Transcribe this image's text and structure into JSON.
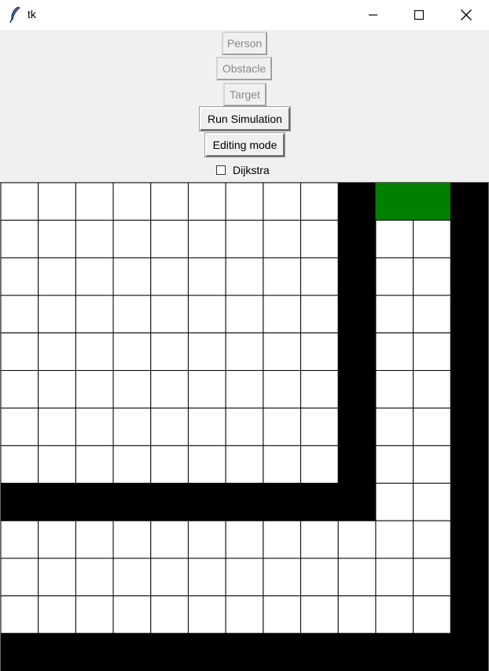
{
  "window": {
    "title": "tk",
    "icon": "feather-icon",
    "controls": [
      "minimize-icon",
      "maximize-icon",
      "close-icon"
    ]
  },
  "toolbar": {
    "person_label": "Person",
    "obstacle_label": "Obstacle",
    "target_label": "Target",
    "run_label": "Run Simulation",
    "editing_label": "Editing mode",
    "dijkstra_label": "Dijkstra",
    "dijkstra_checked": false
  },
  "grid": {
    "cols": 13,
    "rows": 13,
    "colors": {
      "empty": "#ffffff",
      "obstacle": "#000000",
      "target": "#008000",
      "line": "#000000"
    },
    "obstacle_cells": [
      [
        9,
        0
      ],
      [
        9,
        1
      ],
      [
        9,
        2
      ],
      [
        9,
        3
      ],
      [
        9,
        4
      ],
      [
        9,
        5
      ],
      [
        9,
        6
      ],
      [
        9,
        7
      ],
      [
        9,
        8
      ],
      [
        0,
        8
      ],
      [
        1,
        8
      ],
      [
        2,
        8
      ],
      [
        3,
        8
      ],
      [
        4,
        8
      ],
      [
        5,
        8
      ],
      [
        6,
        8
      ],
      [
        7,
        8
      ],
      [
        8,
        8
      ],
      [
        12,
        0
      ],
      [
        12,
        1
      ],
      [
        12,
        2
      ],
      [
        12,
        3
      ],
      [
        12,
        4
      ],
      [
        12,
        5
      ],
      [
        12,
        6
      ],
      [
        12,
        7
      ],
      [
        12,
        8
      ],
      [
        12,
        9
      ],
      [
        12,
        10
      ],
      [
        12,
        11
      ],
      [
        12,
        12
      ],
      [
        0,
        12
      ],
      [
        1,
        12
      ],
      [
        2,
        12
      ],
      [
        3,
        12
      ],
      [
        4,
        12
      ],
      [
        5,
        12
      ],
      [
        6,
        12
      ],
      [
        7,
        12
      ],
      [
        8,
        12
      ],
      [
        9,
        12
      ],
      [
        10,
        12
      ],
      [
        11,
        12
      ]
    ],
    "target_cells": [
      [
        10,
        0
      ],
      [
        11,
        0
      ]
    ]
  }
}
